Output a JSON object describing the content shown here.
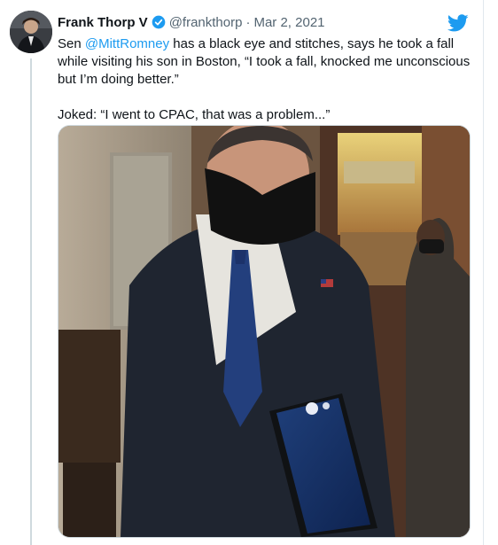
{
  "tweet": {
    "author_name": "Frank Thorp V",
    "handle": "@frankthorp",
    "separator": "·",
    "date": "Mar 2, 2021",
    "text_prefix": "Sen ",
    "mention": "@MittRomney",
    "text_rest": " has a black eye and stitches, says he took a fall while visiting his son in Boston, “I took a fall, knocked me unconscious but I’m doing better.”",
    "text_second": "Joked: “I went to CPAC, that was a problem...”"
  },
  "icons": {
    "verified": "verified-badge-icon",
    "platform": "twitter-bird-icon"
  },
  "colors": {
    "accent": "#1d9bf0",
    "text": "#0f1419",
    "secondary": "#536471"
  }
}
